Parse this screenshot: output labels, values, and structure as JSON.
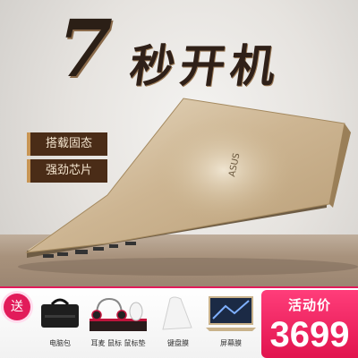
{
  "headline": {
    "number": "7",
    "text": "秒开机"
  },
  "features": [
    {
      "label": "搭载固态"
    },
    {
      "label": "强劲芯片"
    }
  ],
  "gift": {
    "badge": "送"
  },
  "accessories": [
    {
      "label": "电脑包",
      "icon": "laptop-bag-icon"
    },
    {
      "label": "耳麦 鼠标 鼠标垫",
      "icon": "headset-mouse-pad-icon"
    },
    {
      "label": "键盘膜",
      "icon": "keyboard-film-icon"
    },
    {
      "label": "屏幕膜",
      "icon": "screen-film-icon"
    }
  ],
  "promo": {
    "label": "活动价",
    "price": "3699"
  },
  "colors": {
    "accent": "#e21b5a",
    "tag_bg": "#4a2c17",
    "laptop_gold": "#c9b28b"
  }
}
